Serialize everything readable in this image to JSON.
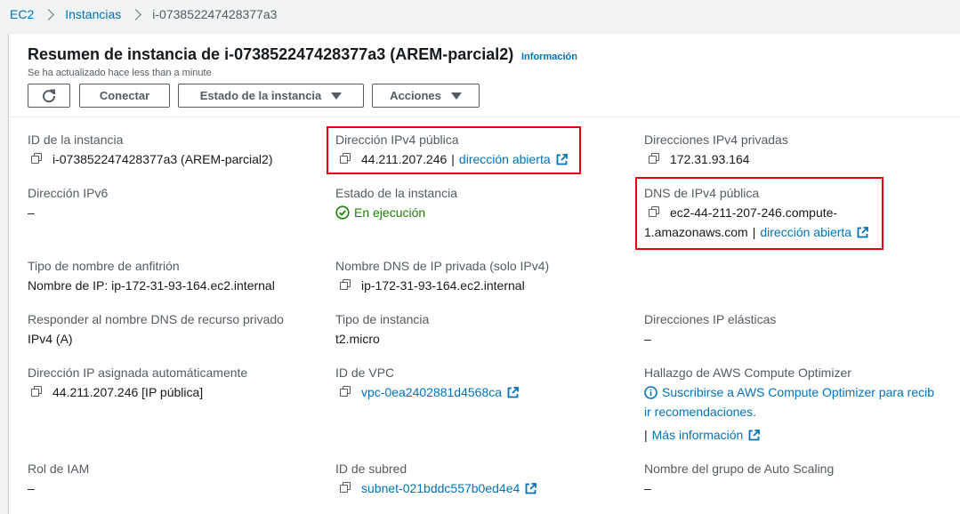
{
  "breadcrumb": {
    "items": [
      "EC2",
      "Instancias"
    ],
    "current": "i-073852247428377a3"
  },
  "header": {
    "title": "Resumen de instancia de i-073852247428377a3 (AREM-parcial2)",
    "info_link": "Información",
    "updated": "Se ha actualizado hace less than a minute"
  },
  "buttons": {
    "refresh_icon": "refresh-icon",
    "connect": "Conectar",
    "instance_state": "Estado de la instancia",
    "actions": "Acciones"
  },
  "fields": {
    "instance_id": {
      "label": "ID de la instancia",
      "value": "i-073852247428377a3 (AREM-parcial2)"
    },
    "public_ipv4": {
      "label": "Dirección IPv4 pública",
      "value": "44.211.207.246",
      "separator": "|",
      "link": "dirección abierta"
    },
    "private_ipv4": {
      "label": "Direcciones IPv4 privadas",
      "value": "172.31.93.164"
    },
    "ipv6": {
      "label": "Dirección IPv6",
      "value": "–"
    },
    "instance_state": {
      "label": "Estado de la instancia",
      "value": "En ejecución"
    },
    "public_dns": {
      "label": "DNS de IPv4 pública",
      "value_line1": "ec2-44-211-207-246.compute-",
      "value_line2": "1.amazonaws.com",
      "separator": "|",
      "link": "dirección abierta"
    },
    "hostname_type": {
      "label": "Tipo de nombre de anfitrión",
      "value": "Nombre de IP: ip-172-31-93-164.ec2.internal"
    },
    "private_dns": {
      "label": "Nombre DNS de IP privada (solo IPv4)",
      "value": "ip-172-31-93-164.ec2.internal"
    },
    "resource_dns": {
      "label": "Responder al nombre DNS de recurso privado",
      "value": "IPv4 (A)"
    },
    "instance_type": {
      "label": "Tipo de instancia",
      "value": "t2.micro"
    },
    "elastic_ip": {
      "label": "Direcciones IP elásticas",
      "value": "–"
    },
    "auto_ip": {
      "label": "Dirección IP asignada automáticamente",
      "value": "44.211.207.246 [IP pública]"
    },
    "vpc_id": {
      "label": "ID de VPC",
      "value": "vpc-0ea2402881d4568ca"
    },
    "compute_optimizer": {
      "label": "Hallazgo de AWS Compute Optimizer",
      "link_line1": "Suscribirse a AWS Compute Optimizer para recib",
      "link_line2": "ir recomendaciones.",
      "separator": "|",
      "more": "Más información"
    },
    "iam_role": {
      "label": "Rol de IAM",
      "value": "–"
    },
    "subnet_id": {
      "label": "ID de subred",
      "value": "subnet-021bddc557b0ed4e4"
    },
    "asg_name": {
      "label": "Nombre del grupo de Auto Scaling",
      "value": "–"
    }
  },
  "colors": {
    "link": "#0073bb",
    "success": "#1d8102",
    "highlight": "#e3000f"
  }
}
